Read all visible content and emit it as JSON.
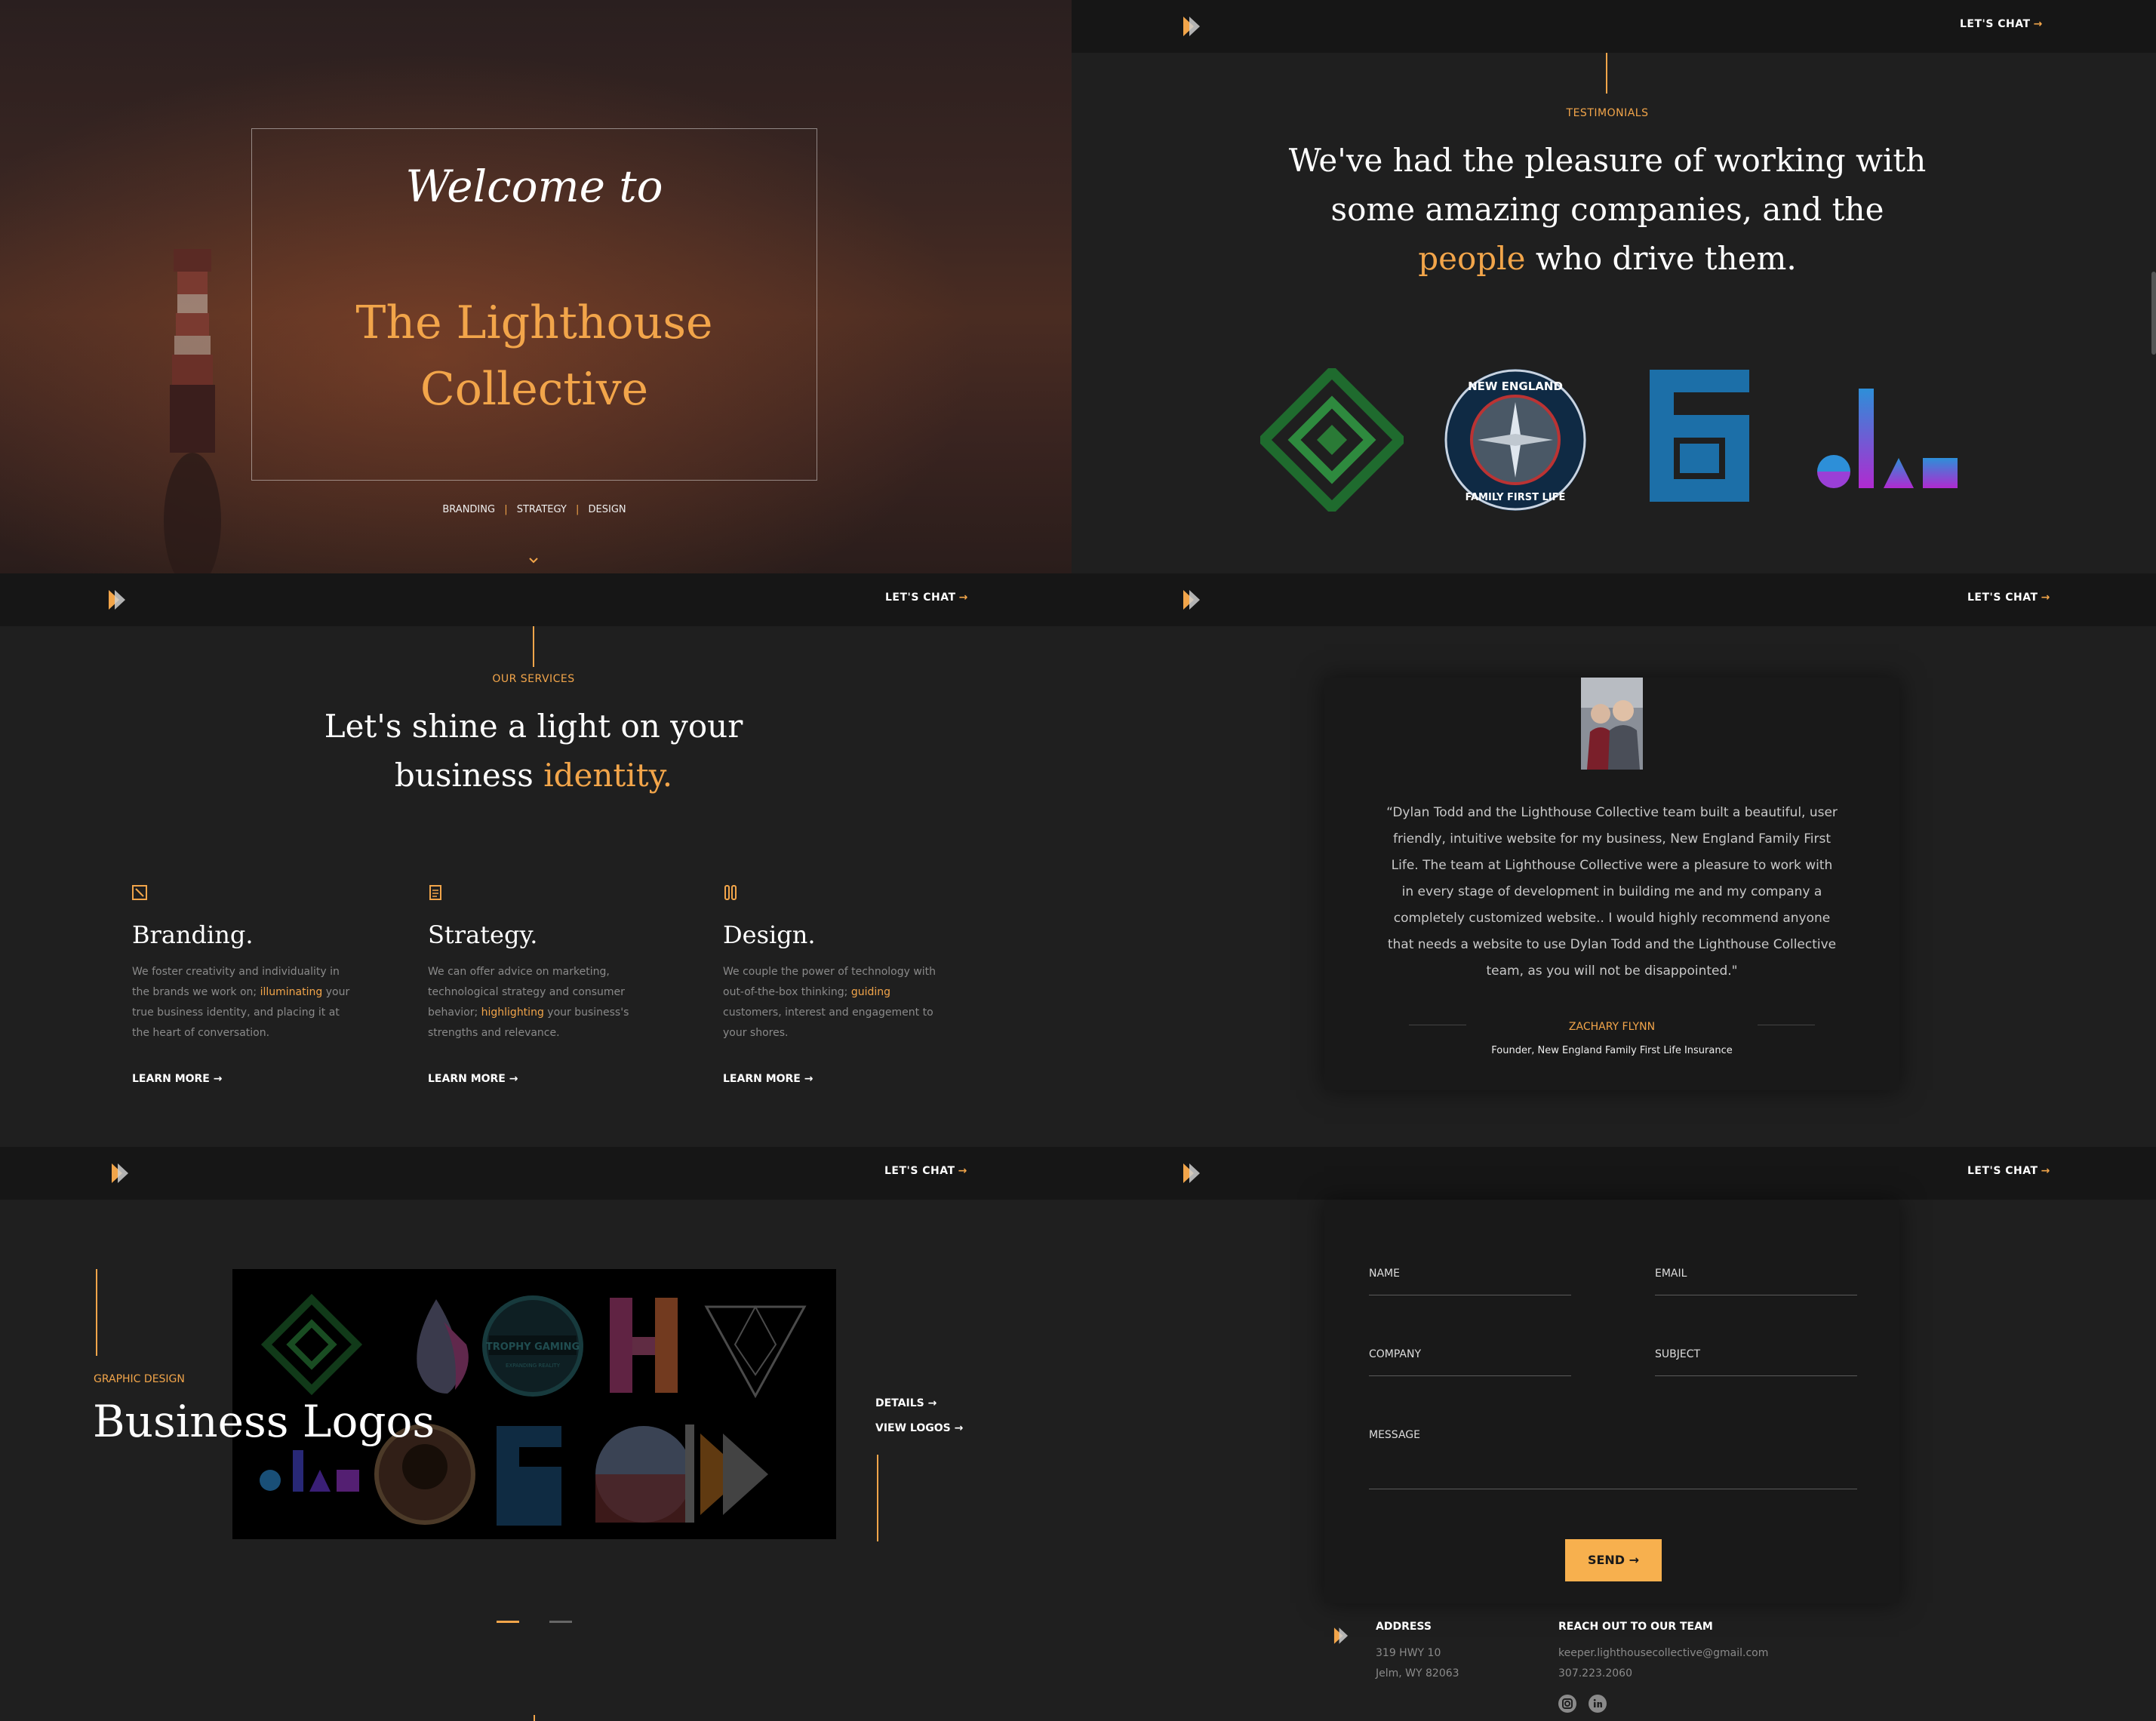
{
  "nav": {
    "chat_label": "LET'S CHAT",
    "chat_arrow": "→",
    "logo_icon": "lighthouse-arrow-logo"
  },
  "hero": {
    "welcome": "Welcome to",
    "title_line1": "The Lighthouse",
    "title_line2": "Collective",
    "tags": [
      "BRANDING",
      "STRATEGY",
      "DESIGN"
    ],
    "scroll_icon": "chevron-down-icon"
  },
  "testimonials_intro": {
    "eyebrow": "TESTIMONIALS",
    "line1": "We've had the pleasure of working with",
    "line2": "some amazing companies, and the",
    "highlight": "people",
    "line3_rest": "who drive them.",
    "badge_top": "NEW ENGLAND",
    "badge_bottom": "FAMILY FIRST LIFE"
  },
  "services": {
    "eyebrow": "OUR SERVICES",
    "line1": "Let's shine a light on your",
    "line2_plain": "business",
    "line2_highlight": "identity.",
    "items": [
      {
        "icon": "pencil-square-icon",
        "title": "Branding.",
        "desc_before": "We foster creativity and individuality in the brands we work on;",
        "desc_highlight": "illuminating",
        "desc_after": "your true business identity, and placing it at the heart of conversation.",
        "more": "LEARN MORE →"
      },
      {
        "icon": "document-icon",
        "title": "Strategy.",
        "desc_before": "We can offer advice on marketing, technological strategy and consumer behavior;",
        "desc_highlight": "highlighting",
        "desc_after": "your business's strengths and relevance.",
        "more": "LEARN MORE →"
      },
      {
        "icon": "tools-icon",
        "title": "Design.",
        "desc_before": "We couple the power of technology with out-of-the-box thinking;",
        "desc_highlight": "guiding",
        "desc_after": "customers, interest and engagement to your shores.",
        "more": "LEARN MORE →"
      }
    ]
  },
  "testimonial": {
    "quote": "“Dylan Todd and the Lighthouse Collective team built a beautiful, user friendly, intuitive website for my business, New England Family First Life. The team at Lighthouse Collective were a pleasure to work with in every stage of development in building me and my company a completely customized website.. I would highly recommend anyone that needs a website to use Dylan Todd and the Lighthouse Collective team, as you will not be disappointed.\"",
    "author": "ZACHARY FLYNN",
    "role": "Founder, New England Family First Life Insurance"
  },
  "portfolio": {
    "eyebrow": "GRAPHIC DESIGN",
    "title": "Business Logos",
    "details": "DETAILS →",
    "view": "VIEW LOGOS →",
    "trophy_top": "TROPHY GAMING",
    "trophy_bottom": "EXPANDING REALITY"
  },
  "contact": {
    "name": "NAME",
    "email": "EMAIL",
    "company": "COMPANY",
    "subject": "SUBJECT",
    "message": "MESSAGE",
    "send": "SEND →"
  },
  "footer": {
    "address_title": "ADDRESS",
    "address_line1": "319 HWY 10",
    "address_line2": "Jelm, WY 82063",
    "reach_title": "REACH OUT TO OUR TEAM",
    "email": "keeper.lighthousecollective@gmail.com",
    "phone": "307.223.2060",
    "social": [
      "instagram-icon",
      "linkedin-icon"
    ]
  },
  "colors": {
    "accent": "#f2a54a",
    "bg": "#1f1f1f",
    "nav": "#161616"
  }
}
